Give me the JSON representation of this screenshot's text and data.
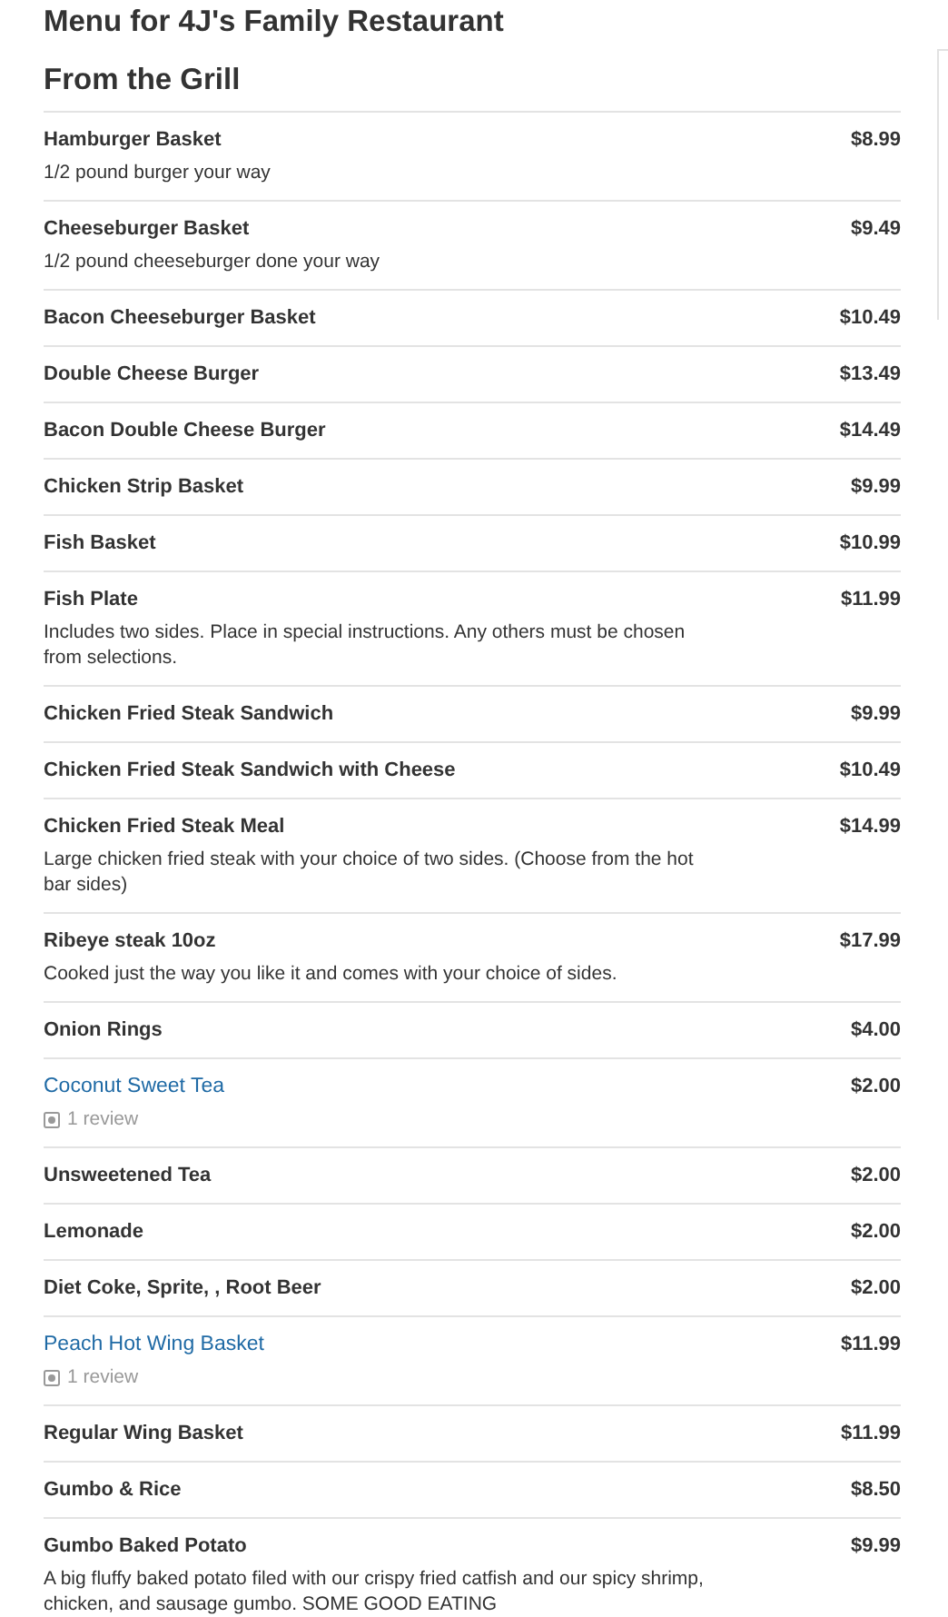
{
  "title": "Menu for 4J's Family Restaurant",
  "section": "From the Grill",
  "items": [
    {
      "name": "Hamburger Basket",
      "price": "$8.99",
      "description": "1/2 pound burger your way",
      "link": false
    },
    {
      "name": "Cheeseburger Basket",
      "price": "$9.49",
      "description": "1/2 pound cheeseburger done your way",
      "link": false
    },
    {
      "name": "Bacon Cheeseburger Basket",
      "price": "$10.49",
      "link": false
    },
    {
      "name": "Double Cheese Burger",
      "price": "$13.49",
      "link": false
    },
    {
      "name": "Bacon Double Cheese Burger",
      "price": "$14.49",
      "link": false
    },
    {
      "name": "Chicken Strip Basket",
      "price": "$9.99",
      "link": false
    },
    {
      "name": "Fish Basket",
      "price": "$10.99",
      "link": false
    },
    {
      "name": "Fish Plate",
      "price": "$11.99",
      "description": "Includes two sides. Place in special instructions. Any others must be chosen from selections.",
      "link": false
    },
    {
      "name": "Chicken Fried Steak Sandwich",
      "price": "$9.99",
      "link": false
    },
    {
      "name": "Chicken Fried Steak Sandwich with Cheese",
      "price": "$10.49",
      "link": false
    },
    {
      "name": "Chicken Fried Steak Meal",
      "price": "$14.99",
      "description": "Large chicken fried steak with your choice of two sides. (Choose from the hot bar sides)",
      "link": false
    },
    {
      "name": "Ribeye steak 10oz",
      "price": "$17.99",
      "description": "Cooked just the way you like it and comes with your choice of sides.",
      "link": false
    },
    {
      "name": "Onion Rings",
      "price": "$4.00",
      "link": false
    },
    {
      "name": "Coconut Sweet Tea",
      "price": "$2.00",
      "link": true,
      "reviews": "1 review"
    },
    {
      "name": "Unsweetened Tea",
      "price": "$2.00",
      "link": false
    },
    {
      "name": "Lemonade",
      "price": "$2.00",
      "link": false
    },
    {
      "name": "Diet Coke, Sprite, , Root Beer",
      "price": "$2.00",
      "link": false
    },
    {
      "name": "Peach Hot Wing Basket",
      "price": "$11.99",
      "link": true,
      "reviews": "1 review"
    },
    {
      "name": "Regular Wing Basket",
      "price": "$11.99",
      "link": false
    },
    {
      "name": "Gumbo & Rice",
      "price": "$8.50",
      "link": false
    },
    {
      "name": "Gumbo Baked Potato",
      "price": "$9.99",
      "description": "A big fluffy baked potato filed with our crispy fried catfish and our spicy shrimp, chicken, and sausage gumbo. SOME GOOD EATING",
      "link": false
    }
  ]
}
